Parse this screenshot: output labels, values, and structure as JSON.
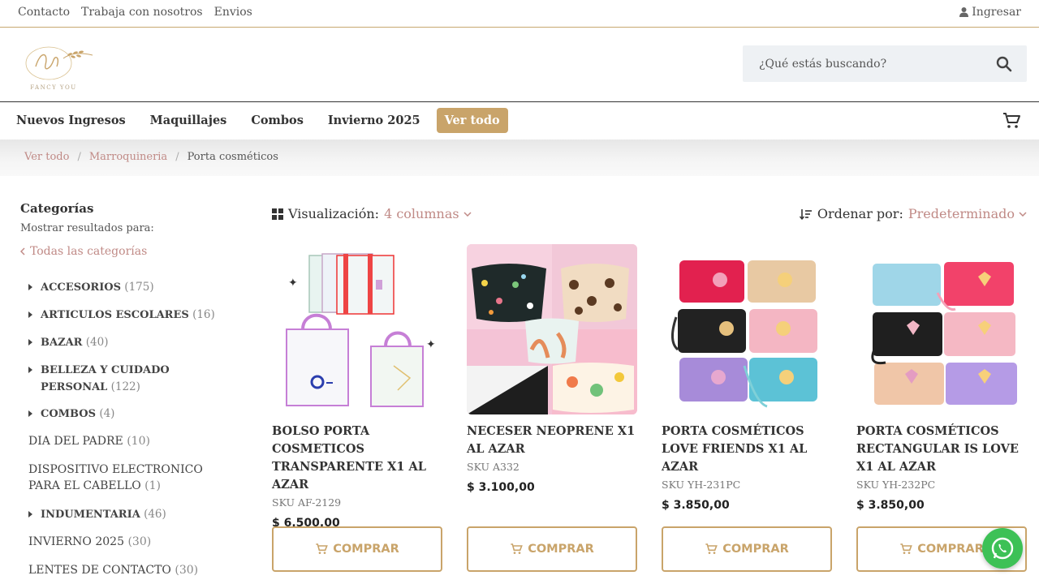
{
  "topbar": {
    "links": [
      "Contacto",
      "Trabaja con nosotros",
      "Envios"
    ],
    "login": "Ingresar"
  },
  "header": {
    "logo_text": "FANCY YOU",
    "search_placeholder": "¿Qué estás buscando?"
  },
  "nav": {
    "items": [
      "Nuevos Ingresos",
      "Maquillajes",
      "Combos",
      "Invierno 2025"
    ],
    "highlight": "Ver todo"
  },
  "breadcrumb": {
    "items": [
      "Ver todo",
      "Marroquineria"
    ],
    "separator": "/",
    "current": "Porta cosméticos"
  },
  "sidebar": {
    "title": "Categorías",
    "subtitle": "Mostrar resultados para:",
    "all_label": "Todas las categorías",
    "categories": [
      {
        "label": "ACCESORIOS",
        "count": "(175)",
        "expandable": true
      },
      {
        "label": "ARTICULOS ESCOLARES",
        "count": "(16)",
        "expandable": true
      },
      {
        "label": "BAZAR",
        "count": "(40)",
        "expandable": true
      },
      {
        "label": "BELLEZA Y CUIDADO PERSONAL",
        "count": "(122)",
        "expandable": true
      },
      {
        "label": "COMBOS",
        "count": "(4)",
        "expandable": true
      },
      {
        "label": "DIA DEL PADRE",
        "count": "(10)",
        "expandable": false
      },
      {
        "label": "DISPOSITIVO ELECTRONICO PARA EL CABELLO",
        "count": "(1)",
        "expandable": false
      },
      {
        "label": "INDUMENTARIA",
        "count": "(46)",
        "expandable": true
      },
      {
        "label": "INVIERNO 2025",
        "count": "(30)",
        "expandable": false
      },
      {
        "label": "LENTES DE CONTACTO",
        "count": "(30)",
        "expandable": false
      }
    ]
  },
  "toolbar": {
    "view_label": "Visualización:",
    "view_value": "4 columnas",
    "sort_label": "Ordenar por:",
    "sort_value": "Predeterminado"
  },
  "products": [
    {
      "name": "BOLSO PORTA COSMETICOS TRANSPARENTE X1 AL AZAR",
      "sku": "SKU AF-2129",
      "price": "$  6.500,00"
    },
    {
      "name": "NECESER NEOPRENE X1 AL AZAR",
      "sku": "SKU A332",
      "price": "$  3.100,00"
    },
    {
      "name": "PORTA COSMÉTICOS LOVE FRIENDS X1 AL AZAR",
      "sku": "SKU YH-231PC",
      "price": "$  3.850,00"
    },
    {
      "name": "PORTA COSMÉTICOS RECTANGULAR IS LOVE X1 AL AZAR",
      "sku": "SKU YH-232PC",
      "price": "$  3.850,00"
    }
  ],
  "buy_label": "COMPRAR",
  "colors": {
    "accent": "#c9a46a",
    "link": "#c08a86",
    "whatsapp": "#3dc156"
  }
}
